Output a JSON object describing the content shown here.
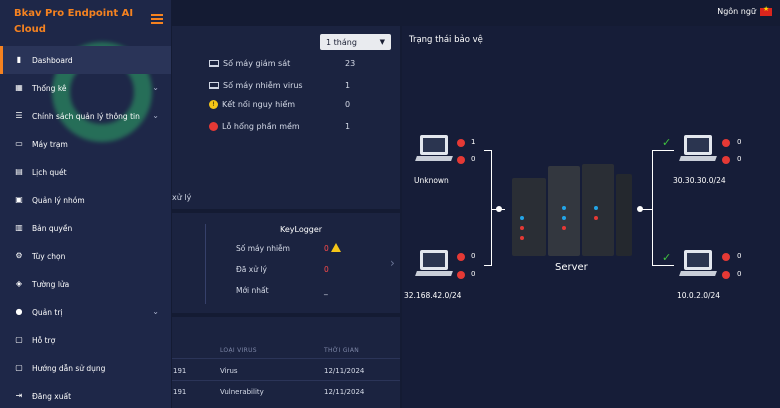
{
  "app": {
    "brand": "Bkav Pro Endpoint AI Cloud",
    "language_label": "Ngôn ngữ"
  },
  "dashboard": {
    "period_selected": "1 tháng",
    "stats": [
      {
        "label": "Số máy giám sát",
        "value": "23",
        "icon": "monitor-icon"
      },
      {
        "label": "Số máy nhiễm virus",
        "value": "1",
        "icon": "monitor-icon"
      },
      {
        "label": "Kết nối nguy hiểm",
        "value": "0",
        "icon": "warning-icon"
      },
      {
        "label": "Lỗ hổng phần mềm",
        "value": "1",
        "icon": "bug-icon"
      }
    ],
    "pane_fragment": "xử lý",
    "keylogger": {
      "title": "KeyLogger",
      "rows": [
        {
          "label": "Số máy nhiễm",
          "value": "0"
        },
        {
          "label": "Đã xử lý",
          "value": "0"
        },
        {
          "label": "Mới nhất",
          "value": "_"
        }
      ]
    },
    "table": {
      "headers": [
        "LOẠI VIRUS",
        "THỜI GIAN"
      ],
      "rows": [
        {
          "id": "191",
          "type": "Virus",
          "time": "12/11/2024"
        },
        {
          "id": "191",
          "type": "Vulnerability",
          "time": "12/11/2024"
        }
      ]
    }
  },
  "protection": {
    "title": "Trạng thái bảo vệ",
    "server_label": "Server",
    "nodes": [
      {
        "label": "Unknown",
        "v1": "1",
        "v2": "0"
      },
      {
        "label": "32.168.42.0/24",
        "v1": "0",
        "v2": "0"
      },
      {
        "label": "30.30.30.0/24",
        "v1": "0",
        "v2": "0"
      },
      {
        "label": "10.0.2.0/24",
        "v1": "0",
        "v2": "0"
      }
    ]
  },
  "sidebar": {
    "items": [
      {
        "label": "Dashboard",
        "icon": "bar-chart-icon",
        "active": true
      },
      {
        "label": "Thống kê",
        "icon": "stats-icon",
        "chevron": true
      },
      {
        "label": "Chính sách quản lý thông tin",
        "icon": "policy-icon",
        "chevron": true
      },
      {
        "label": "Máy trạm",
        "icon": "monitor-icon"
      },
      {
        "label": "Lịch quét",
        "icon": "calendar-icon"
      },
      {
        "label": "Quản lý nhóm",
        "icon": "group-icon"
      },
      {
        "label": "Bản quyền",
        "icon": "license-icon"
      },
      {
        "label": "Tùy chọn",
        "icon": "gear-icon"
      },
      {
        "label": "Tường lửa",
        "icon": "firewall-icon"
      },
      {
        "label": "Quản trị",
        "icon": "user-icon",
        "chevron": true
      },
      {
        "label": "Hỗ trợ",
        "icon": "support-icon"
      },
      {
        "label": "Hướng dẫn sử dụng",
        "icon": "guide-icon"
      },
      {
        "label": "Đăng xuất",
        "icon": "logout-icon"
      }
    ]
  }
}
